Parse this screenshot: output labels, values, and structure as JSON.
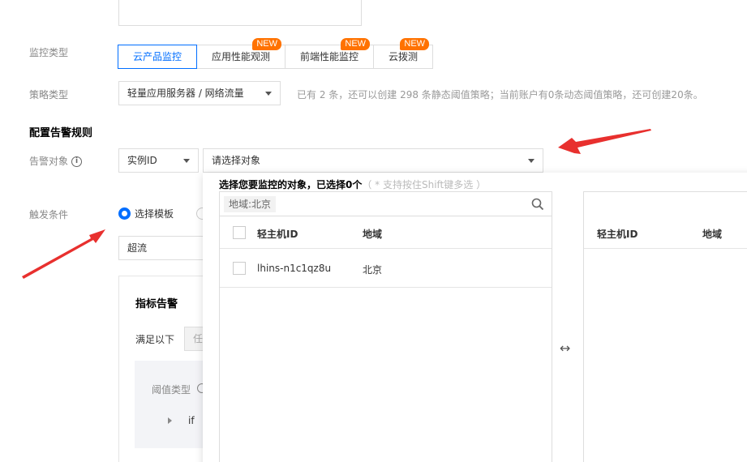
{
  "form": {
    "monitor_type_label": "监控类型",
    "tabs": [
      {
        "label": "云产品监控",
        "badge": ""
      },
      {
        "label": "应用性能观测",
        "badge": "NEW"
      },
      {
        "label": "前端性能监控",
        "badge": "NEW"
      },
      {
        "label": "云拨测",
        "badge": "NEW"
      }
    ],
    "strategy_type_label": "策略类型",
    "strategy_type_value": "轻量应用服务器 / 网络流量",
    "strategy_hint": "已有 2 条，还可以创建 298 条静态阈值策略；当前账户有0条动态阈值策略，还可创建20条。",
    "rules_title": "配置告警规则",
    "alarm_object_label": "告警对象",
    "instance_select_value": "实例ID",
    "object_select_placeholder": "请选择对象",
    "trigger_label": "触发条件",
    "radio_template_label": "选择模板",
    "template_value": "超流",
    "metric_alarm_title": "指标告警",
    "satisfy_label": "满足以下",
    "satisfy_partial": "任",
    "threshold_type_label": "阈值类型",
    "if_label": "if"
  },
  "dropdown": {
    "title": "选择您要监控的对象，已选择0个",
    "hint": "（ * 支持按住Shift键多选 ）",
    "filter_tag": "地域:北京",
    "left_columns": [
      "轻主机ID",
      "地域"
    ],
    "rows": [
      {
        "id": "lhins-n1c1qz8u",
        "region": "北京"
      }
    ],
    "right_columns": [
      "轻主机ID",
      "地域"
    ],
    "transfer_icon": "↔"
  },
  "colors": {
    "primary": "#006eff",
    "badge": "#ff7200",
    "arrow": "#e8302e"
  }
}
